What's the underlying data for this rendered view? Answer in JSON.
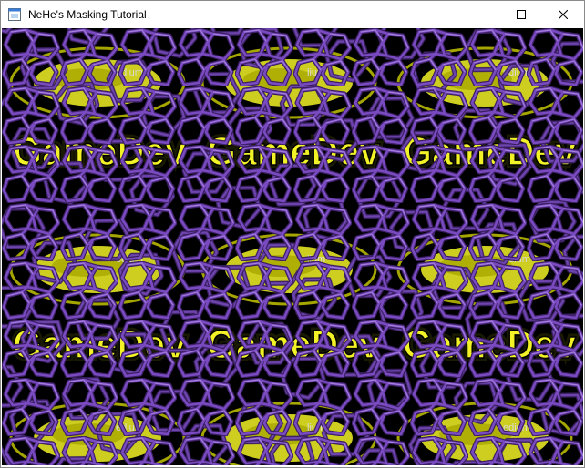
{
  "window": {
    "title": "NeHe's Masking Tutorial",
    "minimize_icon": "minimize-icon",
    "maximize_icon": "maximize-icon",
    "close_icon": "close-icon",
    "app_icon": "opengl-window-icon"
  },
  "scene": {
    "background_color": "#000000",
    "mesh_color": "#6b3fa8",
    "mesh_highlight": "#9a74d6",
    "logo_fill": "#f2f226",
    "logo_outline": "#1a1a00",
    "ring_color": "#b8b800",
    "logo_texts": [
      "GameDev",
      "GameDev",
      "GameDev",
      "GameDev",
      "GameDev",
      "GameDev"
    ],
    "small_label_a": "lium",
    "small_label_b": "edium"
  }
}
